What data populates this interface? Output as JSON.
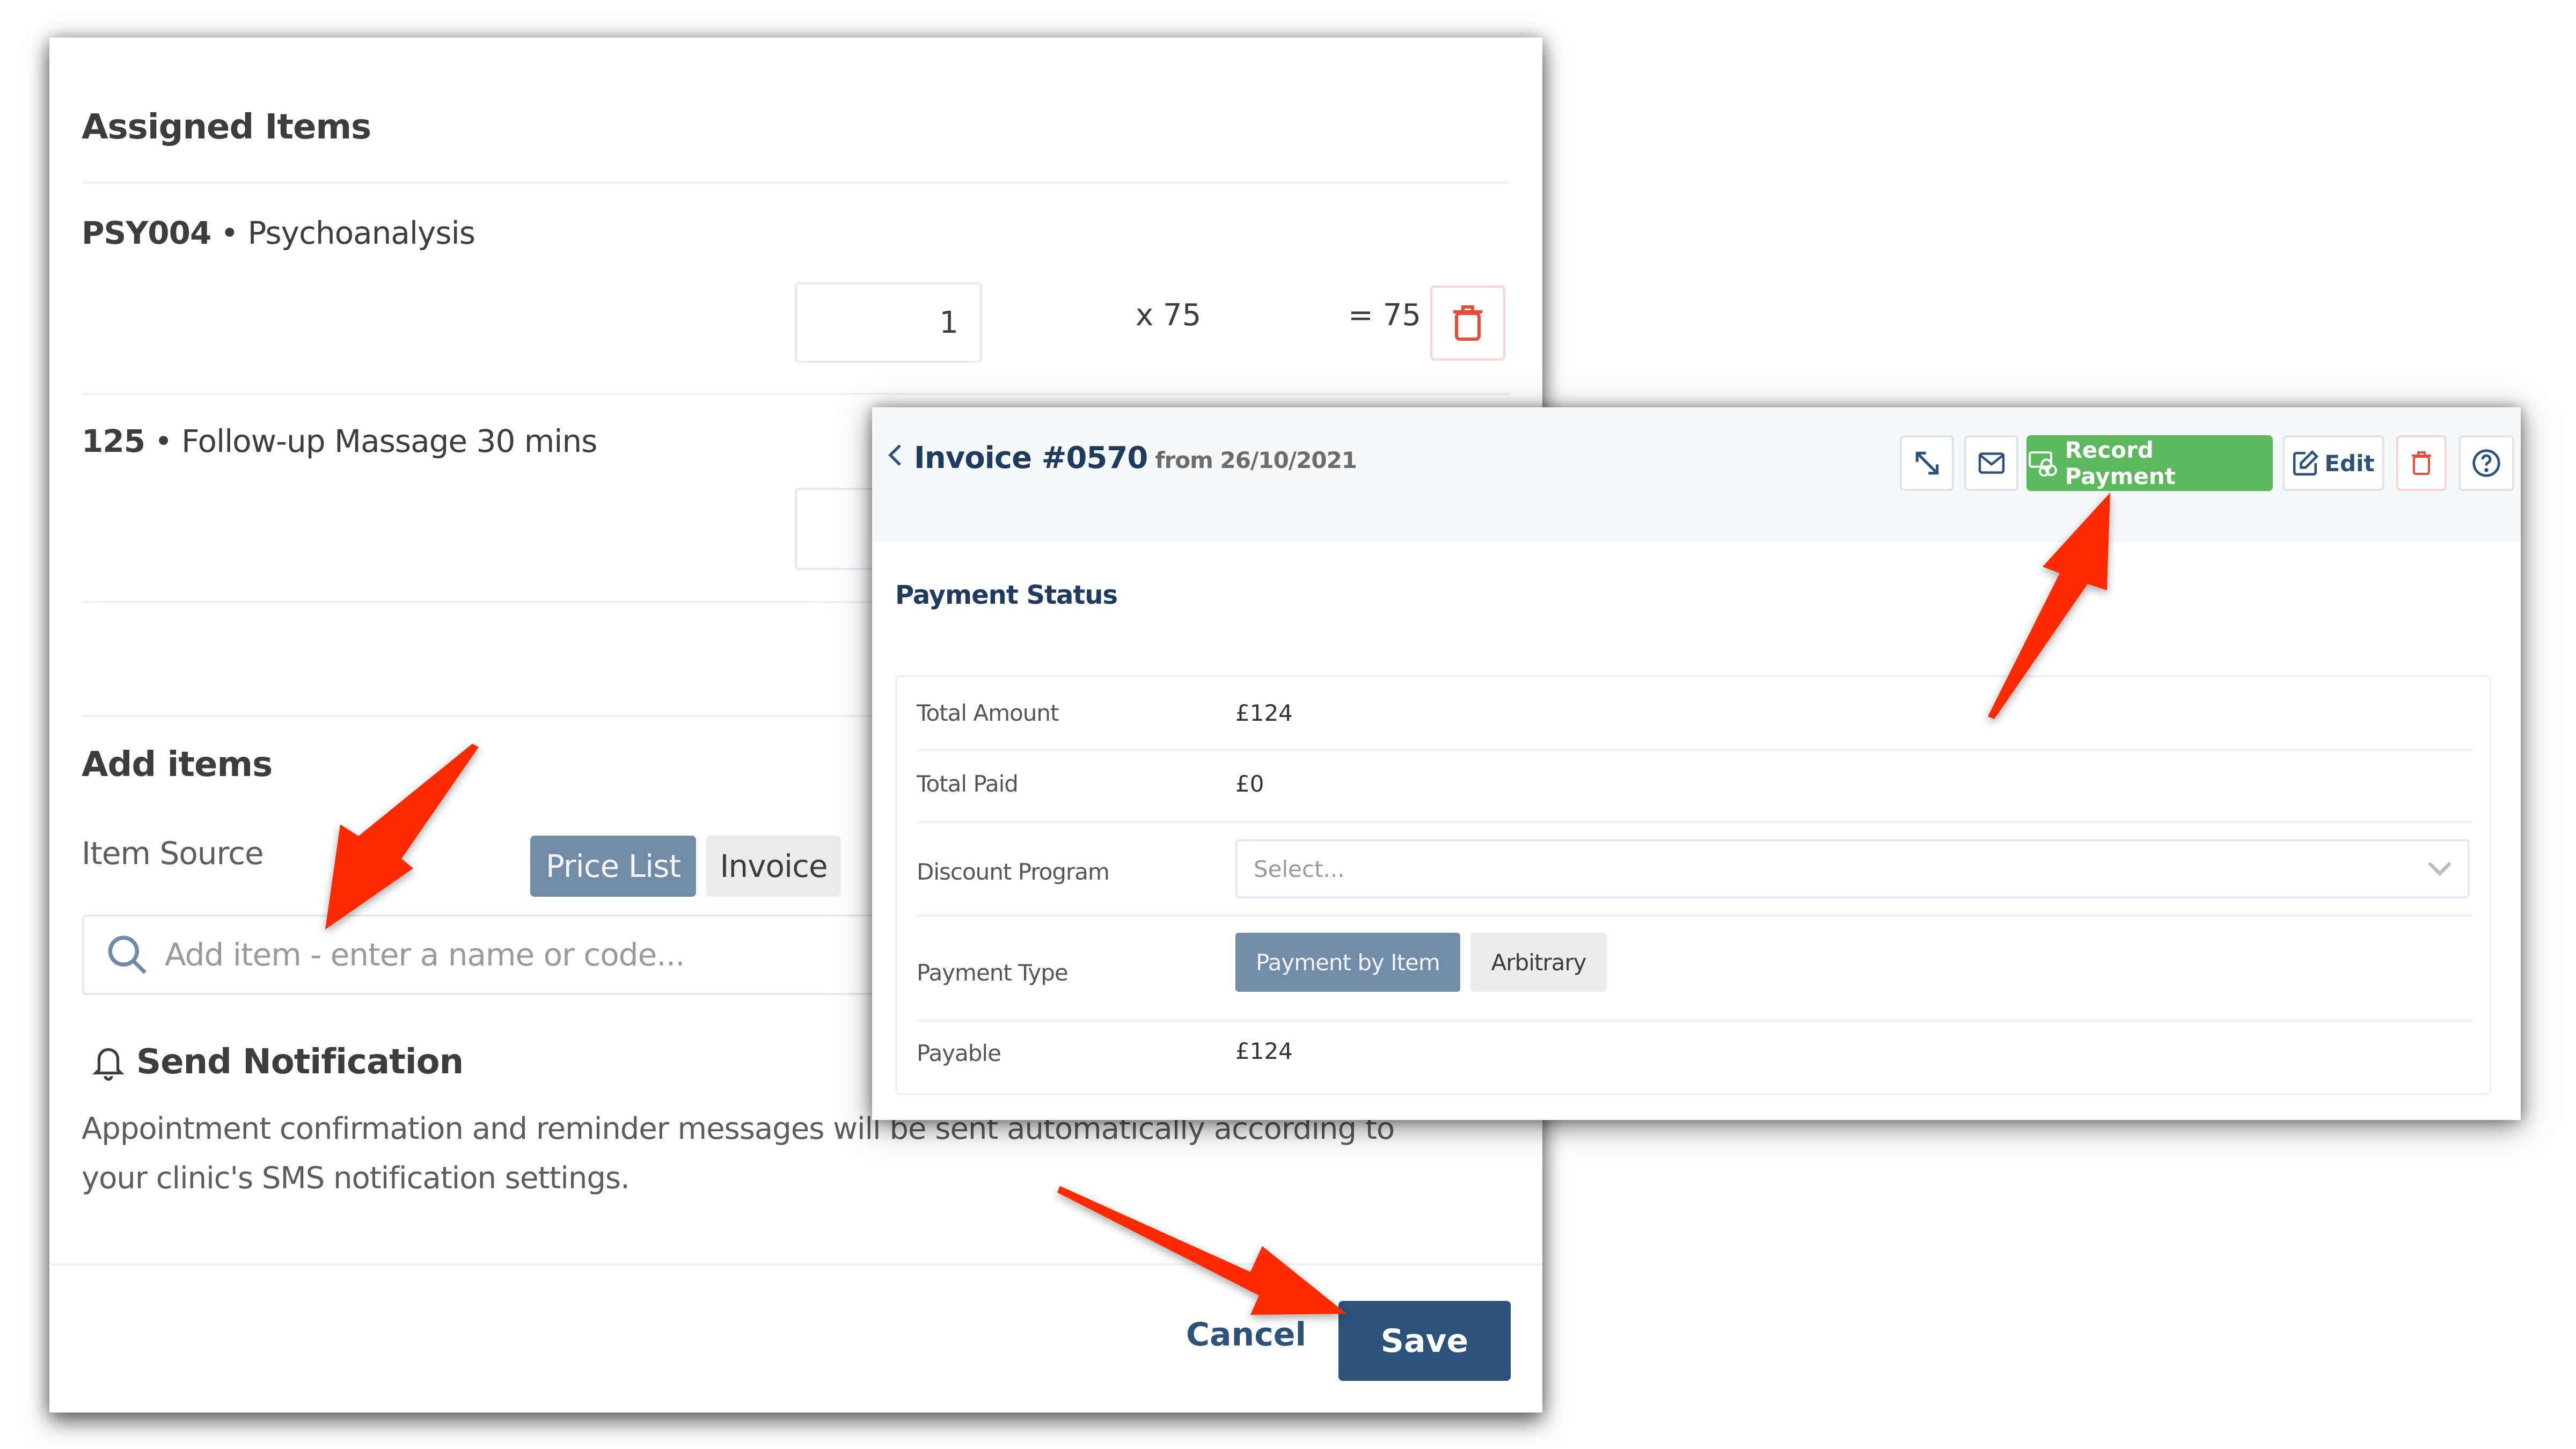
{
  "assigned": {
    "heading": "Assigned Items",
    "items": [
      {
        "code": "PSY004",
        "separator": " • ",
        "name": "Psychoanalysis",
        "quantity": "1",
        "unit_price": "x 75",
        "total": "= 75"
      },
      {
        "code": "125",
        "separator": " • ",
        "name": "Follow-up Massage 30 mins",
        "quantity": ""
      }
    ]
  },
  "add_items": {
    "heading": "Add items",
    "item_source_label": "Item Source",
    "source_options": [
      {
        "label": "Price List",
        "active": true
      },
      {
        "label": "Invoice",
        "active": false
      }
    ],
    "search_placeholder": "Add item - enter a name or code..."
  },
  "notification": {
    "heading": "Send Notification",
    "text_line1": "Appointment confirmation and reminder messages will be sent automatically according to",
    "text_line2": "your clinic's SMS notification settings."
  },
  "footer": {
    "cancel_label": "Cancel",
    "save_label": "Save"
  },
  "invoice": {
    "title": "Invoice #0570",
    "date_text": "from 26/10/2021",
    "toolbar": {
      "expand_icon": "expand-icon",
      "email_icon": "mail-icon",
      "record_payment_label": "Record Payment",
      "edit_label": "Edit",
      "delete_icon": "trash-icon",
      "help_icon": "help-icon"
    },
    "payment_status": {
      "heading": "Payment Status",
      "total_amount_label": "Total Amount",
      "total_amount_value": "£124",
      "total_paid_label": "Total Paid",
      "total_paid_value": "£0",
      "discount_label": "Discount Program",
      "discount_placeholder": "Select...",
      "payment_type_label": "Payment Type",
      "payment_type_options": [
        {
          "label": "Payment by Item",
          "active": true
        },
        {
          "label": "Arbitrary",
          "active": false
        }
      ],
      "payable_label": "Payable",
      "payable_value": "£124"
    }
  },
  "colors": {
    "primary": "#2c5279",
    "success": "#5cb85c",
    "danger": "#e74c3c",
    "segment_active": "#728ba6",
    "annotation_arrow": "#ff2a00"
  }
}
